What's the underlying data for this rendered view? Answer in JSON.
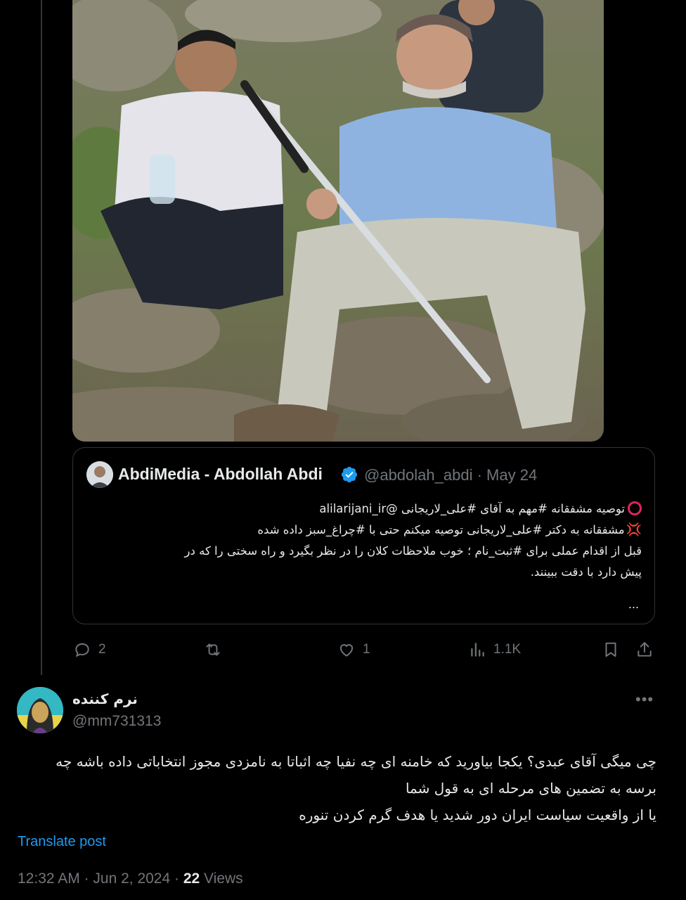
{
  "quoted_post": {
    "author_name": "AbdiMedia - Abdollah Abdi",
    "author_handle": "@abdolah_abdi",
    "date": "May 24",
    "lines": [
      "توصیه مشفقانه #مهم به آقای #علی_لاریجانی @alilarijani_ir",
      "مشفقانه به دکتر #علی_لاریجانی توصیه میکنم حتی با #چراغ_سبز داده شده",
      "قبل از اقدام عملی برای #ثبت_نام ؛ خوب ملاحظات کلان را در نظر بگیرد و راه سختی را که در",
      "پیش دارد با دقت ببینند."
    ],
    "more": "..."
  },
  "actions": {
    "replies": "2",
    "reposts": "",
    "likes": "1",
    "views": "1.1K"
  },
  "reply": {
    "author_name": "نرم کننده",
    "author_handle": "@mm731313",
    "more": "•••",
    "lines": [
      "چی میگی آقای عبدی؟ یکجا بیاورید که خامنه ای چه نفیا چه اثباتا به نامزدی مجوز  انتخاباتی داده باشه چه",
      "برسه به تضمین های مرحله ای به قول شما",
      "یا از واقعیت سیاست ایران دور شدید یا هدف گرم کردن تنوره"
    ],
    "translate_label": "Translate post",
    "time": "12:32 AM",
    "date": "Jun 2, 2024",
    "views_count": "22",
    "views_label": "Views"
  },
  "colors": {
    "background": "#000000",
    "text": "#e7e9ea",
    "muted": "#71767b",
    "accent": "#1d9bf0",
    "border": "#2f3336"
  },
  "icons": [
    "reply-icon",
    "repost-icon",
    "like-icon",
    "views-icon",
    "bookmark-icon",
    "share-icon",
    "verified-icon",
    "more-icon"
  ]
}
